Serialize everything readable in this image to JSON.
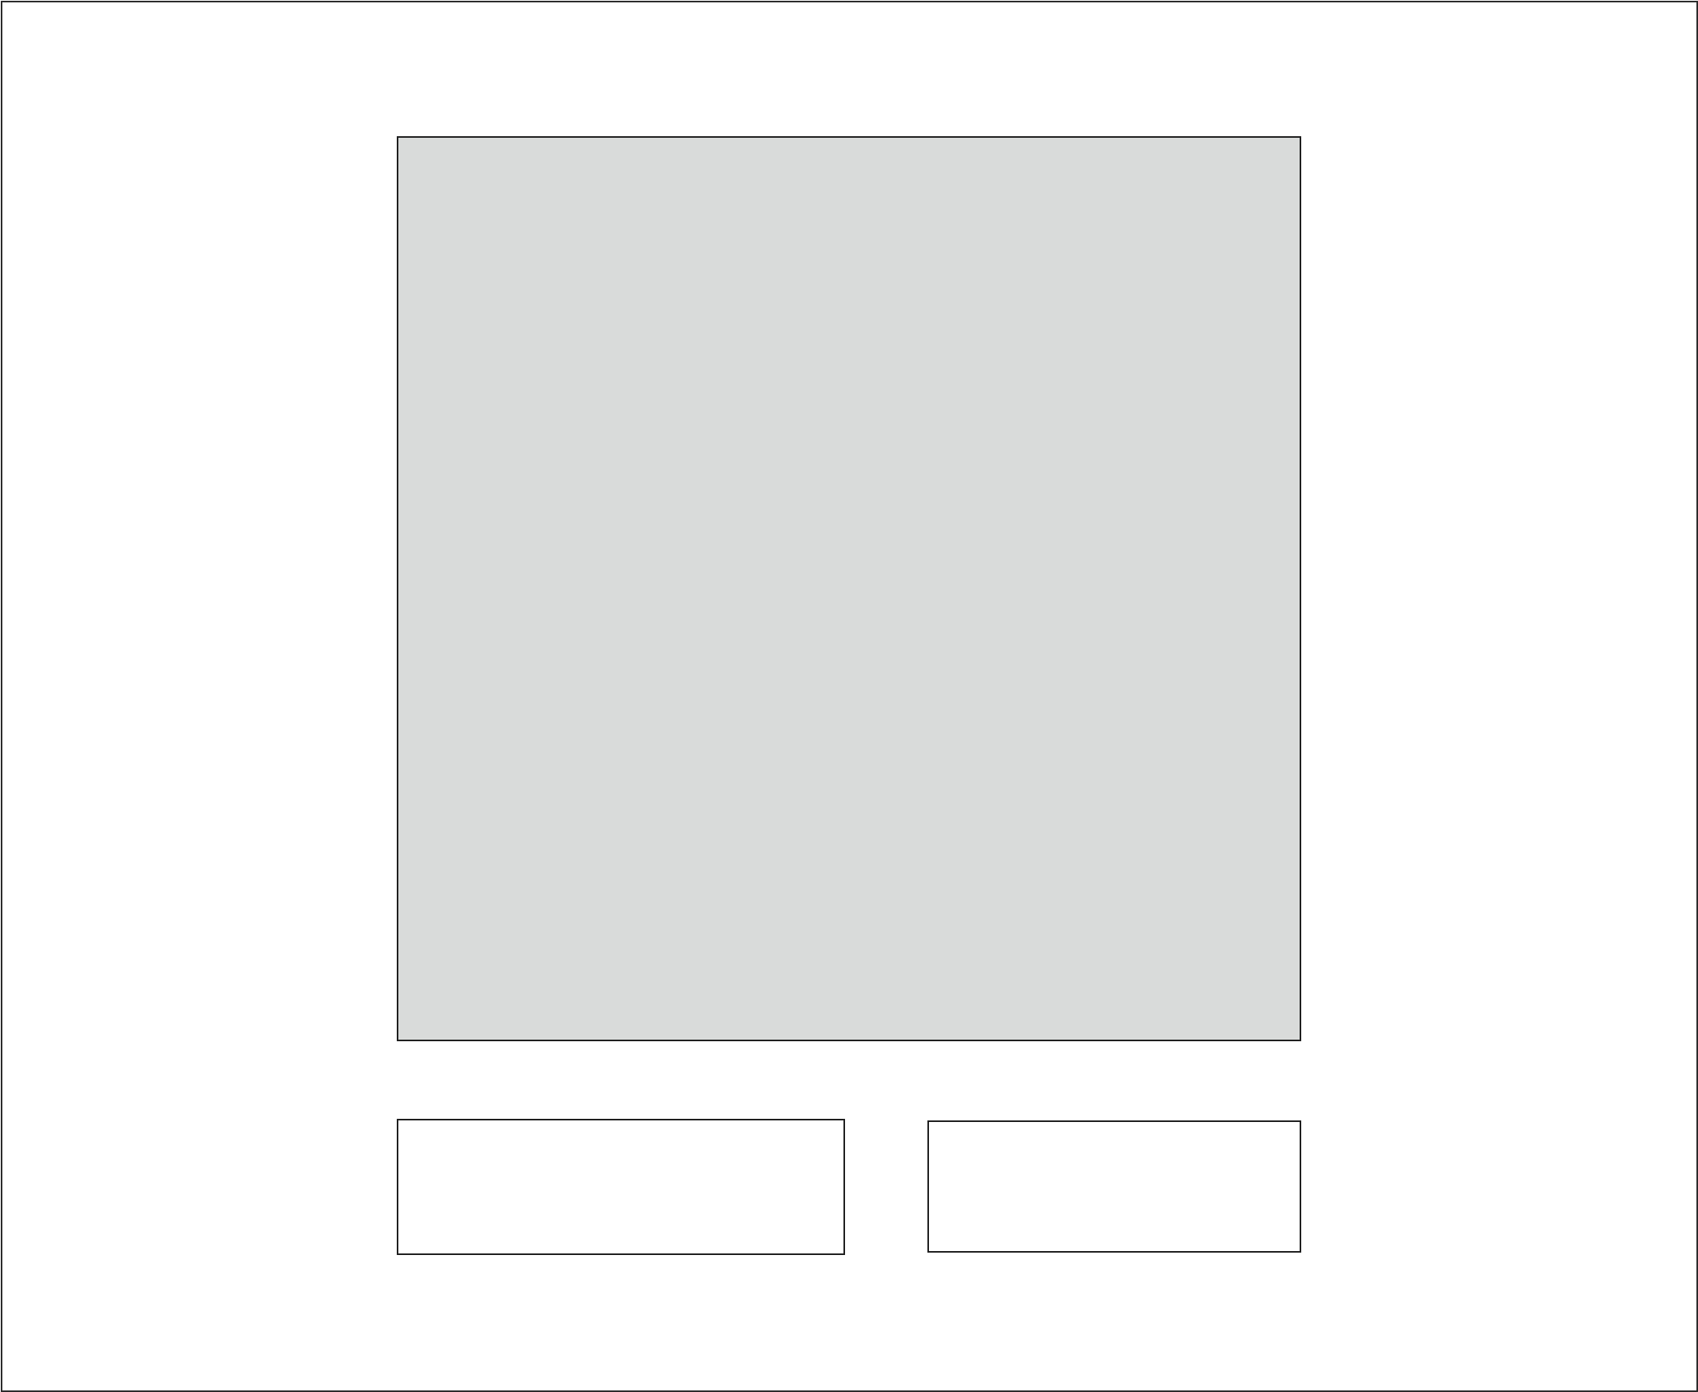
{
  "colors": {
    "frame_border": "#2b2b2b",
    "box_border": "#1e1e1e",
    "main_panel_fill": "#d9dbda",
    "small_box_fill": "#ffffff",
    "background": "#ffffff"
  }
}
